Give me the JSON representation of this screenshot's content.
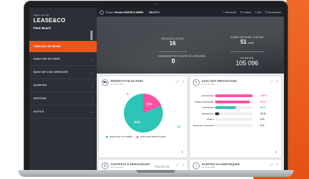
{
  "device_label": "MacBook",
  "app": {
    "logo_small": "MOBILITÉ DE",
    "logo": "LEASE&CO",
    "subtitle": "Fleet Board"
  },
  "sidebar": {
    "items": [
      {
        "label": "TABLEAU DE BORD",
        "active": true
      },
      {
        "label": "ANALYSE DU PARC",
        "chevron": "›"
      },
      {
        "label": "SUIVI DE VOS SERVICES",
        "chevron": "›"
      },
      {
        "label": "ALERTES",
        "chevron": "›"
      },
      {
        "label": "GESTION",
        "chevron": "›"
      },
      {
        "label": "OUTILS",
        "chevron": "›"
      }
    ]
  },
  "topbar": {
    "user_prefix": "Bonjour,",
    "user_name": "Nicolas DUMONT-LAMBIN",
    "selector": "VALLET ▾",
    "links": [
      {
        "icon": "search-icon",
        "glyph": "⌕",
        "label": "Recherche"
      },
      {
        "icon": "mail-icon",
        "glyph": "✉",
        "label": "Contact"
      },
      {
        "icon": "help-icon",
        "glyph": "?",
        "label": "Aide"
      },
      {
        "icon": "logout-icon",
        "glyph": "⏻",
        "label": "Déconnexion"
      }
    ]
  },
  "hero": {
    "stat1": {
      "label": "VÉHICULES ACTIFS",
      "value": "16"
    },
    "stat2": {
      "label": "COMMANDES EN COURS DE LIVRAISON",
      "value": "0"
    },
    "stat3": {
      "label": "DURÉE MOYENNE CONTRAT",
      "value": "51",
      "unit": "mois"
    },
    "stat4": {
      "label": "KM MOYEN",
      "value": "105 096"
    }
  },
  "cards": {
    "parc": {
      "title": "RÉPARTITION DU PARC",
      "subtitle": "au 20.11.2021",
      "legend": [
        {
          "label": "VÉHICULES UTILITAIRES",
          "color": "#2ec4b6"
        },
        {
          "label": "VÉHICULES PARTICULIERS",
          "color": "#ff4fa3"
        }
      ]
    },
    "prestations": {
      "title": "SUIVI DES PRESTATIONS",
      "subtitle": "au 20.11.2021"
    },
    "contrats": {
      "title": "CONTRATS À RENOUVELER",
      "subtitle": "au 20.11.2021"
    },
    "alertes": {
      "title": "ALERTES KILOMÉTRIQUES",
      "subtitle": "au 20.11.2021"
    }
  },
  "chart_data": [
    {
      "type": "pie",
      "slices": [
        {
          "name": "VÉHICULES UTILITAIRES",
          "value": 13,
          "percent_label": "81%",
          "color": "#2ec4b6"
        },
        {
          "name": "VÉHICULES PARTICULIERS",
          "value": 3,
          "percent_label": "19%",
          "color": "#ff4fa3"
        }
      ]
    },
    {
      "type": "bar",
      "orientation": "horizontal",
      "categories": [
        "ASSISTANCE",
        "PERTE FINANCIÈRE",
        "ENTRETIEN",
        "ASSURANCE",
        "PNEUS",
        "VÉHICULE / ACCIDENT / VOL"
      ],
      "values": [
        100,
        93,
        56,
        12,
        0,
        0
      ],
      "value_labels": [
        "100 %",
        "93 %",
        "56 %",
        "12 %",
        "0 %",
        "0 %"
      ],
      "colors": [
        "#ff4fa3",
        "#ff4fa3",
        "#2ec4b6",
        "#2b2f36",
        "#2b2f36",
        "#2b2f36"
      ],
      "xlim": [
        0,
        100
      ]
    }
  ]
}
